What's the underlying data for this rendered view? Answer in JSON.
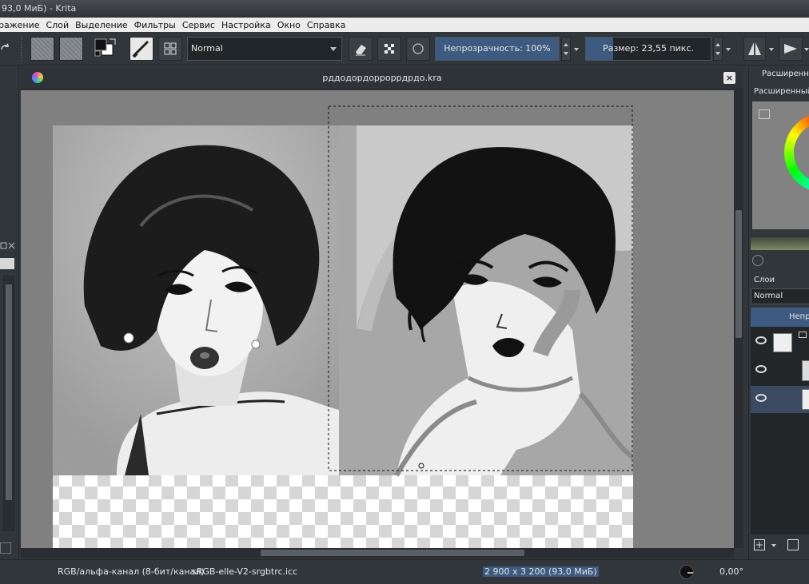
{
  "window": {
    "title": "93,0 МиБ)  - Krita"
  },
  "menu": [
    "ражение",
    "Слой",
    "Выделение",
    "Фильтры",
    "Сервис",
    "Настройка",
    "Окно",
    "Справка"
  ],
  "toolbar": {
    "blend_mode": "Normal",
    "opacity_label": "Непрозрачность: 100%",
    "opacity_value": 100,
    "size_label": "Размер: 23,55 пикс.",
    "size_fraction": 0.22
  },
  "document": {
    "title": "рддодордорроррдрдо.kra",
    "close_symbol": "×"
  },
  "right_dock": {
    "tab_title": "Расширенны",
    "subtitle": "Расширенный в",
    "layers_title": "Слои",
    "layer_blend_mode": "Normal",
    "layer_opacity_label": "Непр",
    "accent_color": "#3d5a80"
  },
  "status": {
    "color_model": "RGB/альфа-канал (8-бит/канал)",
    "profile": "sRGB-elle-V2-srgbtrc.icc",
    "dimensions": "2 900 x 3 200 (93,0 МиБ)",
    "rotation": "0,00°"
  }
}
